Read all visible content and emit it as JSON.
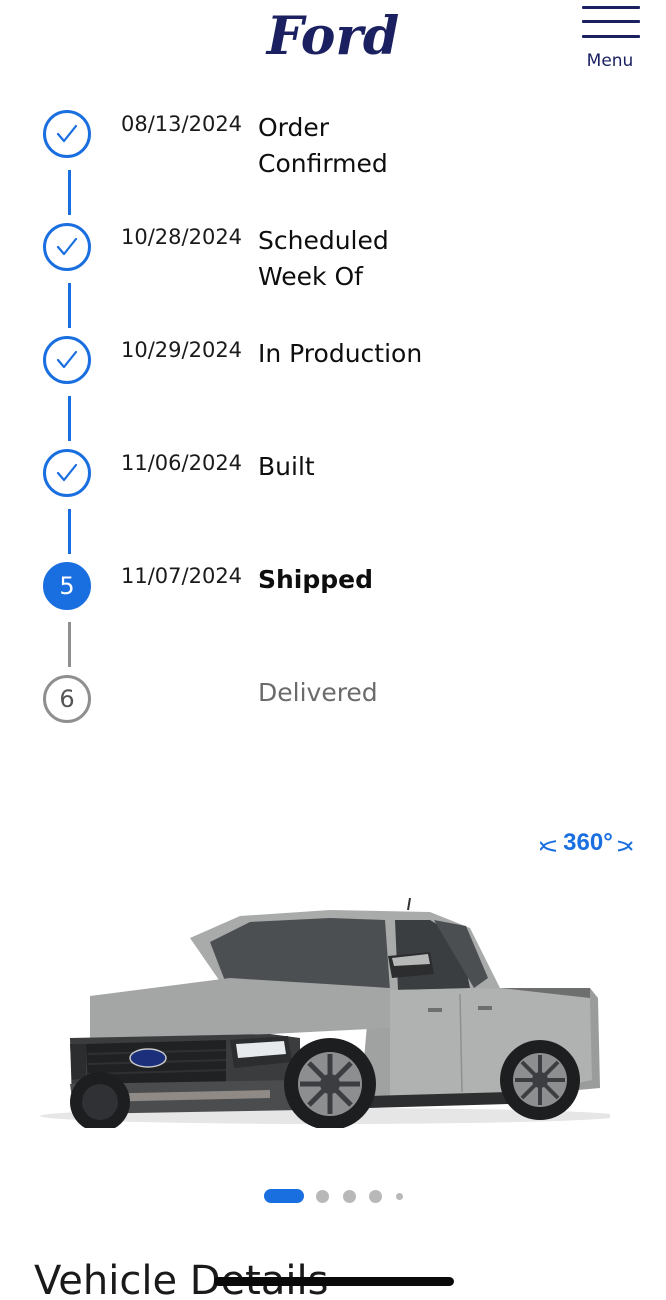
{
  "header": {
    "logo_text": "Ford",
    "menu_label": "Menu",
    "menu_icon": "hamburger-icon"
  },
  "timeline": {
    "steps": [
      {
        "number": "1",
        "status": "done",
        "date": "08/13/2024",
        "label": "Order Confirmed",
        "icon": "check-icon"
      },
      {
        "number": "2",
        "status": "done",
        "date": "10/28/2024",
        "label": "Scheduled Week Of",
        "icon": "check-icon"
      },
      {
        "number": "3",
        "status": "done",
        "date": "10/29/2024",
        "label": "In Production",
        "icon": "check-icon"
      },
      {
        "number": "4",
        "status": "done",
        "date": "11/06/2024",
        "label": "Built",
        "icon": "check-icon"
      },
      {
        "number": "5",
        "status": "current",
        "date": "11/07/2024",
        "label": "Shipped"
      },
      {
        "number": "6",
        "status": "pending",
        "date": "",
        "label": "Delivered"
      }
    ]
  },
  "vehicle": {
    "view_360_label": "360°",
    "view_360_icon": "rotate-360-icon",
    "image": "gray-pickup-truck-image"
  },
  "carousel": {
    "total": 5,
    "active_index": 0
  },
  "section": {
    "title": "Vehicle Details"
  },
  "colors": {
    "accent": "#1a6fe0",
    "brand_navy": "#1b2160",
    "pending": "#8f8f8f"
  }
}
